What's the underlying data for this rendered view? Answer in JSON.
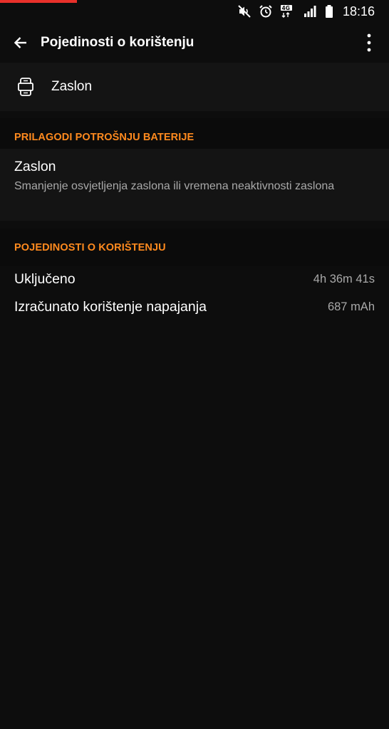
{
  "status_bar": {
    "time": "18:16",
    "icons": [
      "mute-icon",
      "alarm-icon",
      "4g-data-icon",
      "signal-icon",
      "battery-icon"
    ],
    "network_label": "4G"
  },
  "app_bar": {
    "title": "Pojedinosti o korištenju",
    "back_icon": "arrow-left-icon",
    "menu_icon": "more-vertical-icon"
  },
  "app_header": {
    "icon": "screen-device-icon",
    "name": "Zaslon"
  },
  "section_battery": {
    "header": "PRILAGODI POTROŠNJU BATERIJE",
    "item": {
      "title": "Zaslon",
      "summary": "Smanjenje osvjetljenja zaslona ili vremena neaktivnosti zaslona"
    }
  },
  "section_usage": {
    "header": "POJEDINOSTI O KORIŠTENJU",
    "rows": [
      {
        "label": "Uključeno",
        "value": "4h 36m 41s"
      },
      {
        "label": "Izračunato korištenje napajanja",
        "value": "687 mAh"
      }
    ]
  },
  "colors": {
    "accent": "#ff8a1e",
    "background": "#0d0d0d",
    "card": "#141414",
    "secondary_text": "#a9a9a9",
    "progress_strip": "#e8302a"
  }
}
